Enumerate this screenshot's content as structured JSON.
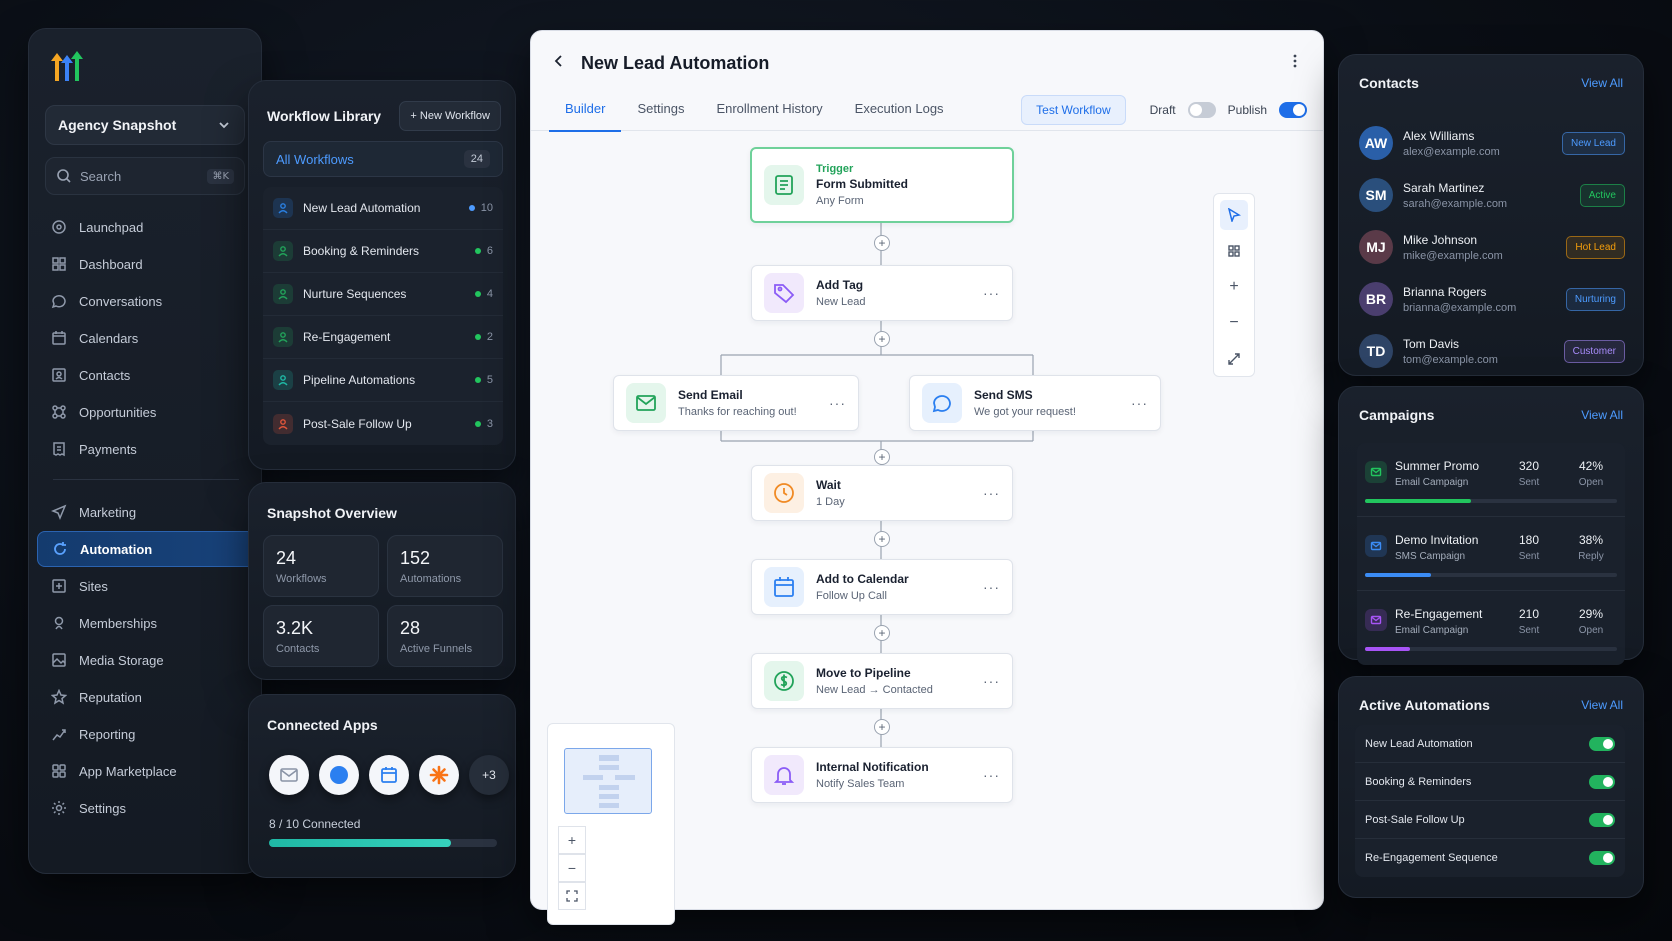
{
  "sidebar": {
    "account": "Agency Snapshot",
    "search_placeholder": "Search",
    "search_shortcut": "⌘K",
    "nav": [
      {
        "label": "Launchpad",
        "icon": "rocket-icon"
      },
      {
        "label": "Dashboard",
        "icon": "grid-icon"
      },
      {
        "label": "Conversations",
        "icon": "chat-icon"
      },
      {
        "label": "Calendars",
        "icon": "calendar-icon"
      },
      {
        "label": "Contacts",
        "icon": "contact-card-icon"
      },
      {
        "label": "Opportunities",
        "icon": "network-icon"
      },
      {
        "label": "Payments",
        "icon": "receipt-icon"
      }
    ],
    "nav2": [
      {
        "label": "Marketing",
        "icon": "send-icon"
      },
      {
        "label": "Automation",
        "icon": "refresh-icon",
        "active": true
      },
      {
        "label": "Sites",
        "icon": "site-icon"
      },
      {
        "label": "Memberships",
        "icon": "user-icon"
      },
      {
        "label": "Media Storage",
        "icon": "image-icon"
      },
      {
        "label": "Reputation",
        "icon": "star-icon"
      },
      {
        "label": "Reporting",
        "icon": "chart-icon"
      },
      {
        "label": "App Marketplace",
        "icon": "apps-icon"
      },
      {
        "label": "Settings",
        "icon": "gear-icon"
      }
    ]
  },
  "library": {
    "title": "Workflow Library",
    "new_button": "New Workflow",
    "all_label": "All Workflows",
    "all_count": "24",
    "items": [
      {
        "label": "New Lead Automation",
        "count": "10",
        "dot": "#4d9bff",
        "icon_color": "#2a7fe0"
      },
      {
        "label": "Booking & Reminders",
        "count": "6",
        "dot": "#22c55e",
        "icon_color": "#22a35a"
      },
      {
        "label": "Nurture Sequences",
        "count": "4",
        "dot": "#22c55e",
        "icon_color": "#22a35a"
      },
      {
        "label": "Re-Engagement",
        "count": "2",
        "dot": "#22c55e",
        "icon_color": "#22a35a"
      },
      {
        "label": "Pipeline Automations",
        "count": "5",
        "dot": "#22c55e",
        "icon_color": "#1fb8a5"
      },
      {
        "label": "Post-Sale Follow Up",
        "count": "3",
        "dot": "#22c55e",
        "icon_color": "#e0553a"
      }
    ]
  },
  "snapshot": {
    "title": "Snapshot Overview",
    "stats": [
      {
        "value": "24",
        "label": "Workflows"
      },
      {
        "value": "152",
        "label": "Automations"
      },
      {
        "value": "3.2K",
        "label": "Contacts"
      },
      {
        "value": "28",
        "label": "Active Funnels"
      }
    ]
  },
  "apps": {
    "title": "Connected Apps",
    "more": "+3",
    "connected_text": "8 / 10 Connected",
    "connected_fraction": 0.8
  },
  "builder": {
    "title": "New Lead Automation",
    "tabs": [
      "Builder",
      "Settings",
      "Enrollment History",
      "Execution Logs"
    ],
    "test_button": "Test Workflow",
    "draft_label": "Draft",
    "publish_label": "Publish",
    "trigger": {
      "label": "Trigger",
      "title": "Form Submitted",
      "sub": "Any Form"
    },
    "add_tag": {
      "title": "Add Tag",
      "sub": "New Lead"
    },
    "send_email": {
      "title": "Send Email",
      "sub": "Thanks for reaching out!"
    },
    "send_sms": {
      "title": "Send SMS",
      "sub": "We got your request!"
    },
    "wait": {
      "title": "Wait",
      "sub": "1 Day"
    },
    "calendar": {
      "title": "Add to Calendar",
      "sub": "Follow Up Call"
    },
    "pipeline": {
      "title": "Move to Pipeline",
      "sub_from": "New Lead",
      "sub_arrow": "→",
      "sub_to": "Contacted"
    },
    "notify": {
      "title": "Internal Notification",
      "sub": "Notify Sales Team"
    },
    "node_more": "···"
  },
  "contacts": {
    "title": "Contacts",
    "view_all": "View All",
    "items": [
      {
        "initials": "AW",
        "name": "Alex Williams",
        "email": "alex@example.com",
        "badge": "New Lead",
        "avatar": "#2a5fa8",
        "badge_color": "#4d9bff"
      },
      {
        "initials": "SM",
        "name": "Sarah Martinez",
        "email": "sarah@example.com",
        "badge": "Active",
        "avatar": "#2a4f7c",
        "badge_color": "#22c55e"
      },
      {
        "initials": "MJ",
        "name": "Mike Johnson",
        "email": "mike@example.com",
        "badge": "Hot Lead",
        "avatar": "#5a3a48",
        "badge_color": "#f59e0b"
      },
      {
        "initials": "BR",
        "name": "Brianna Rogers",
        "email": "brianna@example.com",
        "badge": "Nurturing",
        "avatar": "#4a3e6e",
        "badge_color": "#4d9bff"
      },
      {
        "initials": "TD",
        "name": "Tom Davis",
        "email": "tom@example.com",
        "badge": "Customer",
        "avatar": "#2e4466",
        "badge_color": "#a78bfa"
      }
    ]
  },
  "campaigns": {
    "title": "Campaigns",
    "view_all": "View All",
    "items": [
      {
        "name": "Summer Promo",
        "type": "Email Campaign",
        "count": "320",
        "count_label": "Sent",
        "rate": "42%",
        "rate_label": "Open",
        "progress": 0.42,
        "color": "#22c55e"
      },
      {
        "name": "Demo Invitation",
        "type": "SMS Campaign",
        "count": "180",
        "count_label": "Sent",
        "rate": "38%",
        "rate_label": "Reply",
        "progress": 0.26,
        "color": "#3b8cf5"
      },
      {
        "name": "Re-Engagement",
        "type": "Email Campaign",
        "count": "210",
        "count_label": "Sent",
        "rate": "29%",
        "rate_label": "Open",
        "progress": 0.18,
        "color": "#a855f7"
      }
    ]
  },
  "active_automations": {
    "title": "Active Automations",
    "view_all": "View All",
    "items": [
      {
        "label": "New Lead Automation",
        "on": true
      },
      {
        "label": "Booking & Reminders",
        "on": true
      },
      {
        "label": "Post-Sale Follow Up",
        "on": true
      },
      {
        "label": "Re-Engagement Sequence",
        "on": true
      }
    ]
  }
}
